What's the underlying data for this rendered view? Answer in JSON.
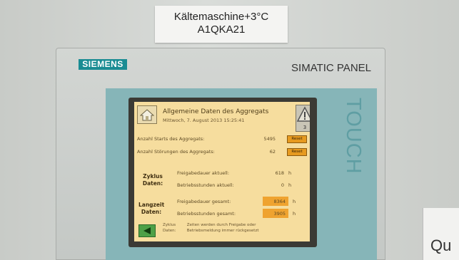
{
  "sign": {
    "line1": "Kältemaschine+3°C",
    "line2": "A1QKA21"
  },
  "panel": {
    "brand": "SIEMENS",
    "model": "SIMATIC PANEL",
    "touch": "TOUCH"
  },
  "side_sign": {
    "text": "Qu"
  },
  "hmi": {
    "title": "Allgemeine Daten des Aggregats",
    "datetime": "Mittwoch, 7. August 2013 15:25:41",
    "home_icon": "home-icon",
    "alarm": {
      "icon": "warning-icon",
      "count": "3"
    },
    "counters": [
      {
        "label": "Anzahl Starts des Aggregats:",
        "value": "5495",
        "button": "Reset"
      },
      {
        "label": "Anzahl Störungen des Aggregats:",
        "value": "62",
        "button": "Reset"
      }
    ],
    "zyklus": {
      "heading_l1": "Zyklus",
      "heading_l2": "Daten:",
      "rows": [
        {
          "label": "Freigabedauer aktuell:",
          "value": "618",
          "unit": "h"
        },
        {
          "label": "Betriebsstunden aktuell:",
          "value": "0",
          "unit": "h"
        }
      ]
    },
    "langzeit": {
      "heading_l1": "Langzeit",
      "heading_l2": "Daten:",
      "rows": [
        {
          "label": "Freigabedauer gesamt:",
          "value": "8364",
          "unit": "h"
        },
        {
          "label": "Betriebsstunden gesamt:",
          "value": "3905",
          "unit": "h"
        }
      ]
    },
    "footer": {
      "col1_l1": "Zyklus",
      "col1_l2": "Daten:",
      "col2_l1": "Zeiten werden durch Freigabe oder",
      "col2_l2": "Betriebsmeldung immer rückgesetzt"
    },
    "colors": {
      "screen_bg": "#f6dd9e",
      "reset_button": "#e79a1f",
      "back_button": "#4ea047"
    }
  }
}
